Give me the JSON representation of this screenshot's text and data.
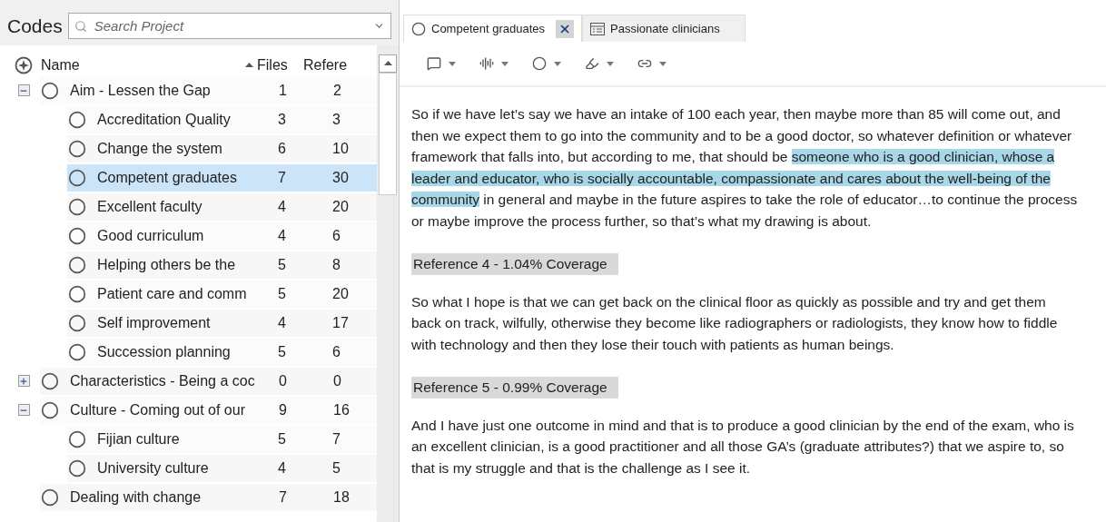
{
  "codes_panel": {
    "title": "Codes",
    "search": {
      "placeholder": "Search Project"
    },
    "columns": [
      {
        "label": "Name",
        "sorted": false
      },
      {
        "label": "Files",
        "sorted": true
      },
      {
        "label": "Refere",
        "sorted": false
      }
    ],
    "tree": [
      {
        "name": "Aim - Lessen the Gap",
        "files": "1",
        "references": "2",
        "selected": false,
        "expanded": true,
        "children": [
          {
            "name": "Accreditation Quality",
            "files": "3",
            "references": "3",
            "selected": false
          },
          {
            "name": "Change the system",
            "files": "6",
            "references": "10",
            "selected": false
          },
          {
            "name": "Competent graduates",
            "files": "7",
            "references": "30",
            "selected": true
          },
          {
            "name": "Excellent faculty",
            "files": "4",
            "references": "20",
            "selected": false
          },
          {
            "name": "Good curriculum",
            "files": "4",
            "references": "6",
            "selected": false
          },
          {
            "name": "Helping others be the",
            "files": "5",
            "references": "8",
            "selected": false
          },
          {
            "name": "Patient care and comm",
            "files": "5",
            "references": "20",
            "selected": false
          },
          {
            "name": "Self improvement",
            "files": "4",
            "references": "17",
            "selected": false
          },
          {
            "name": "Succession planning",
            "files": "5",
            "references": "6",
            "selected": false
          }
        ]
      },
      {
        "name": "Characteristics - Being a coc",
        "files": "0",
        "references": "0",
        "selected": false,
        "expanded": false
      },
      {
        "name": "Culture - Coming out of our",
        "files": "9",
        "references": "16",
        "selected": false,
        "expanded": true,
        "children": [
          {
            "name": "Fijian culture",
            "files": "5",
            "references": "7",
            "selected": false
          },
          {
            "name": "University culture",
            "files": "4",
            "references": "5",
            "selected": false
          }
        ]
      },
      {
        "name": "Dealing with change",
        "files": "7",
        "references": "18",
        "selected": false
      }
    ]
  },
  "detail_panel": {
    "tabs": [
      {
        "label": "Competent graduates",
        "kind": "code",
        "selected": true
      },
      {
        "label": "Passionate clinicians",
        "kind": "document",
        "selected": false
      }
    ],
    "content": [
      {
        "kind": "paragraph",
        "segments": [
          {
            "text": "So if we have let’s say we have an intake of 100 each year, then maybe more than 85 will come out, and then we expect them to go into the community and to be a good doctor, so whatever definition or whatever framework that falls into, but according to me, that should be ",
            "highlighted": false
          },
          {
            "text": "someone who is a good clinician, whose a leader and educator, who is socially accountable, compassionate and cares about the well-being of the community",
            "highlighted": true
          },
          {
            "text": " in general and maybe in the future aspires to take the role of educator…to continue the process or maybe improve the process further, so that’s what my drawing is about.",
            "highlighted": false
          }
        ]
      },
      {
        "kind": "reference",
        "text": "Reference 4 - 1.04% Coverage"
      },
      {
        "kind": "paragraph",
        "segments": [
          {
            "text": "So what I hope is that we can get back on the clinical floor as quickly as possible and try and get them back on track, wilfully, otherwise they become like radiographers or radiologists, they know how to fiddle with technology and then they lose their touch with patients as human beings.",
            "highlighted": false
          }
        ]
      },
      {
        "kind": "reference",
        "text": "Reference 5 - 0.99% Coverage"
      },
      {
        "kind": "paragraph",
        "segments": [
          {
            "text": "And I have just one outcome in mind and that is to produce a good clinician by the end of the exam, who is an excellent clinician, is a good practitioner and all those GA’s (graduate attributes?) that we aspire to, so that is my struggle and that is the challenge as I see it.",
            "highlighted": false
          }
        ]
      }
    ]
  }
}
